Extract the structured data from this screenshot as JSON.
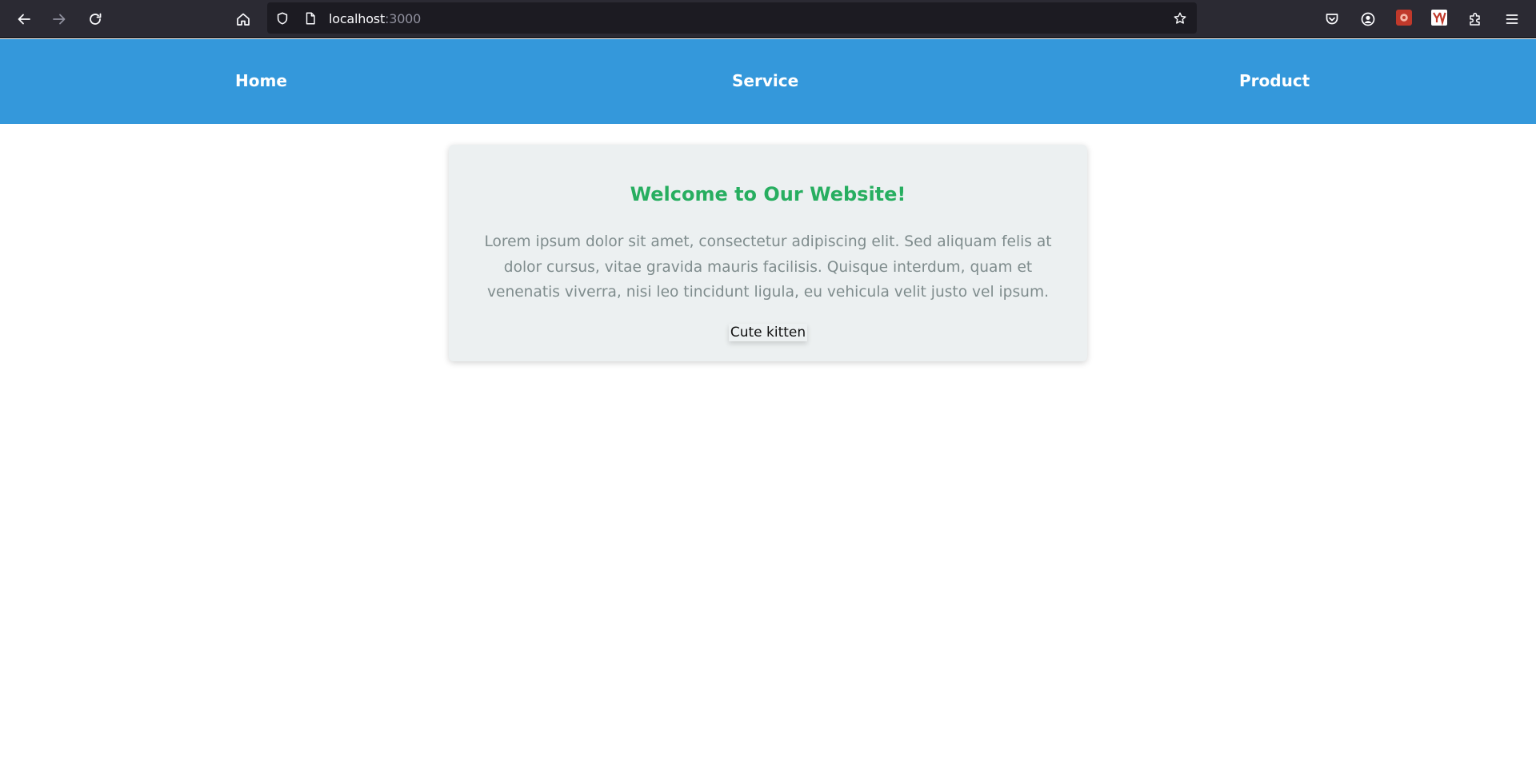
{
  "browser": {
    "url_host": "localhost",
    "url_port": ":3000",
    "icons": {
      "back": "back-arrow-icon",
      "forward": "forward-arrow-icon",
      "reload": "reload-icon",
      "home": "home-icon",
      "tracking": "shield-icon",
      "page": "page-icon",
      "bookmark": "star-icon",
      "pocket": "pocket-icon",
      "account": "account-icon",
      "extensions": "puzzle-icon",
      "menu": "hamburger-menu-icon"
    },
    "extension_badges": [
      "extension-red-icon",
      "extension-yv-icon"
    ]
  },
  "nav": {
    "items": [
      {
        "label": "Home"
      },
      {
        "label": "Service"
      },
      {
        "label": "Product"
      }
    ],
    "background": "#3498db"
  },
  "card": {
    "title": "Welcome to Our Website!",
    "body": "Lorem ipsum dolor sit amet, consectetur adipiscing elit. Sed aliquam felis at dolor cursus, vitae gravida mauris facilisis. Quisque interdum, quam et venenatis viverra, nisi leo tincidunt ligula, eu vehicula velit justo vel ipsum.",
    "button_label": "Cute kitten",
    "title_color": "#27ae60",
    "text_color": "#7f8c8d",
    "background": "#ecf0f1"
  }
}
